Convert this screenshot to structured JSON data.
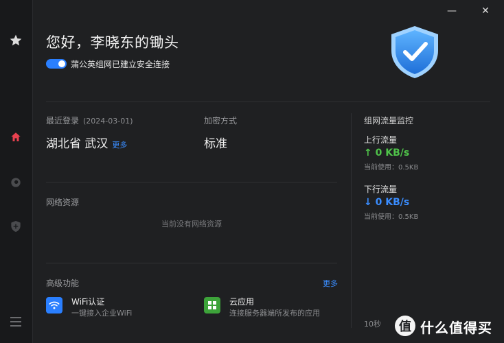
{
  "window": {
    "minimize_glyph": "—",
    "close_glyph": "✕"
  },
  "sidebar": {
    "items": [
      {
        "icon": "star-icon",
        "active": false
      },
      {
        "icon": "home-icon",
        "active": true
      },
      {
        "icon": "disc-icon",
        "active": false
      },
      {
        "icon": "shield-plus-icon",
        "active": false
      },
      {
        "icon": "menu-icon",
        "active": false
      }
    ]
  },
  "header": {
    "greeting": "您好，李晓东的锄头",
    "status": "蒲公英组网已建立安全连接",
    "connected": true
  },
  "login": {
    "label": "最近登录",
    "date": "(2024-03-01)",
    "location": "湖北省 武汉",
    "more": "更多"
  },
  "encryption": {
    "label": "加密方式",
    "value": "标准"
  },
  "resources": {
    "label": "网络资源",
    "empty": "当前没有网络资源"
  },
  "advanced": {
    "label": "高级功能",
    "more": "更多",
    "features": [
      {
        "title": "WiFi认证",
        "desc": "一键接入企业WiFi",
        "icon": "wifi-icon",
        "color": "#2a7fff"
      },
      {
        "title": "云应用",
        "desc": "连接服务器端所发布的应用",
        "icon": "grid-icon",
        "color": "#3da33a"
      }
    ]
  },
  "monitor": {
    "title": "组网流量监控",
    "up": {
      "label": "上行流量",
      "value": "↑ 0 KB/s",
      "used": "当前使用：0.5KB"
    },
    "down": {
      "label": "下行流量",
      "value": "↓ 0 KB/s",
      "used": "当前使用：0.5KB"
    },
    "time": "10秒"
  },
  "watermark": {
    "badge": "值",
    "text": "什么值得买"
  },
  "colors": {
    "accent": "#2a7fff",
    "up": "#4fc34a",
    "down": "#3a8dff",
    "active_nav": "#e8414f"
  }
}
